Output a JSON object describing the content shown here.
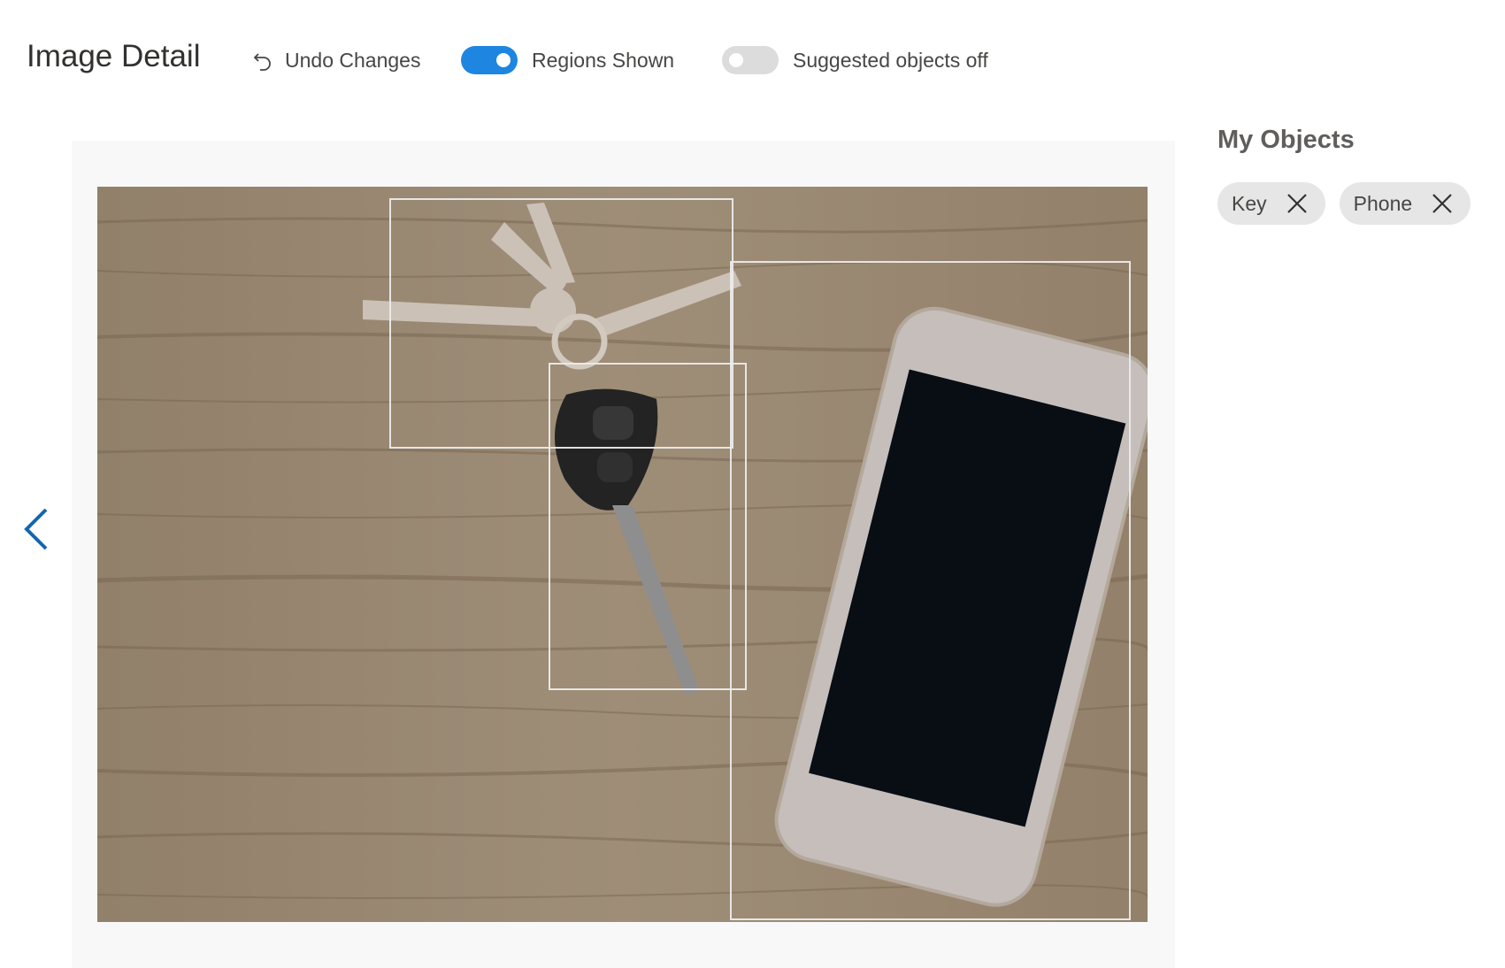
{
  "header": {
    "title": "Image Detail",
    "undo_label": "Undo Changes",
    "undo_icon": "undo-icon",
    "regions_toggle": {
      "label": "Regions Shown",
      "on": true
    },
    "suggested_toggle": {
      "label": "Suggested objects off",
      "on": false
    }
  },
  "colors": {
    "accent": "#1e86e0",
    "toggle_off": "#dcdcdc",
    "chip_bg": "#e6e6e6",
    "nav_arrow": "#1466b0"
  },
  "navigation": {
    "prev_icon": "chevron-left-icon"
  },
  "image": {
    "regions": [
      "Key",
      "Key",
      "Phone"
    ]
  },
  "sidebar": {
    "title": "My Objects",
    "objects": [
      {
        "label": "Key",
        "remove_icon": "close-icon"
      },
      {
        "label": "Phone",
        "remove_icon": "close-icon"
      }
    ]
  }
}
